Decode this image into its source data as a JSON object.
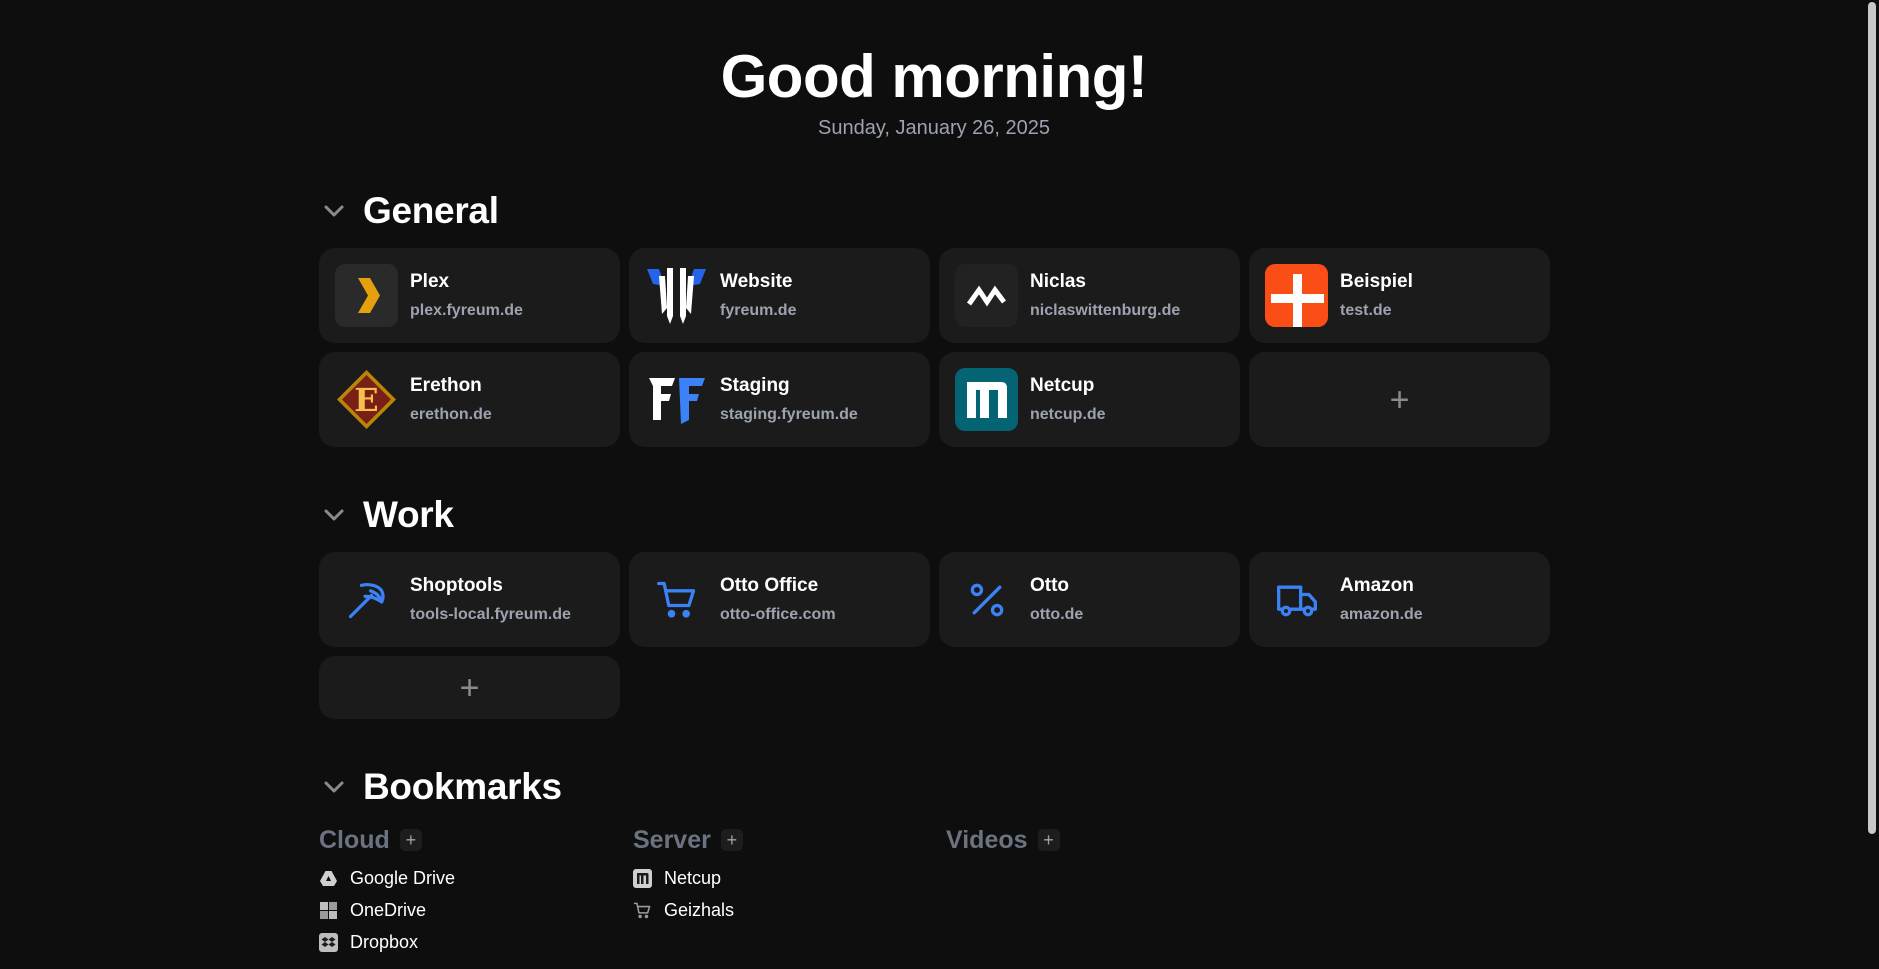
{
  "header": {
    "greeting": "Good morning!",
    "date": "Sunday, January 26, 2025"
  },
  "sections": {
    "general": {
      "title": "General",
      "cards": [
        {
          "title": "Plex",
          "url": "plex.fyreum.de",
          "icon": "plex-icon"
        },
        {
          "title": "Website",
          "url": "fyreum.de",
          "icon": "fyreum-shield-icon"
        },
        {
          "title": "Niclas",
          "url": "niclaswittenburg.de",
          "icon": "niclas-logo-icon"
        },
        {
          "title": "Beispiel",
          "url": "test.de",
          "icon": "beispiel-logo-icon"
        },
        {
          "title": "Erethon",
          "url": "erethon.de",
          "icon": "erethon-emblem-icon"
        },
        {
          "title": "Staging",
          "url": "staging.fyreum.de",
          "icon": "fyreum-staging-icon"
        },
        {
          "title": "Netcup",
          "url": "netcup.de",
          "icon": "netcup-icon"
        }
      ],
      "add_label": "+"
    },
    "work": {
      "title": "Work",
      "cards": [
        {
          "title": "Shoptools",
          "url": "tools-local.fyreum.de",
          "icon": "pickaxe-icon"
        },
        {
          "title": "Otto Office",
          "url": "otto-office.com",
          "icon": "shopping-cart-icon"
        },
        {
          "title": "Otto",
          "url": "otto.de",
          "icon": "percent-icon"
        },
        {
          "title": "Amazon",
          "url": "amazon.de",
          "icon": "truck-icon"
        }
      ],
      "add_label": "+"
    },
    "bookmarks": {
      "title": "Bookmarks",
      "columns": [
        {
          "title": "Cloud",
          "items": [
            {
              "label": "Google Drive",
              "icon": "google-drive-icon"
            },
            {
              "label": "OneDrive",
              "icon": "onedrive-icon"
            },
            {
              "label": "Dropbox",
              "icon": "dropbox-icon"
            }
          ]
        },
        {
          "title": "Server",
          "items": [
            {
              "label": "Netcup",
              "icon": "netcup-icon"
            },
            {
              "label": "Geizhals",
              "icon": "cart-icon"
            }
          ]
        },
        {
          "title": "Videos",
          "items": []
        }
      ],
      "add_label": "+"
    }
  },
  "colors": {
    "background": "#0e0e0e",
    "card": "#1b1b1b",
    "accent_blue": "#3b82f6",
    "muted": "#9ca3af"
  }
}
